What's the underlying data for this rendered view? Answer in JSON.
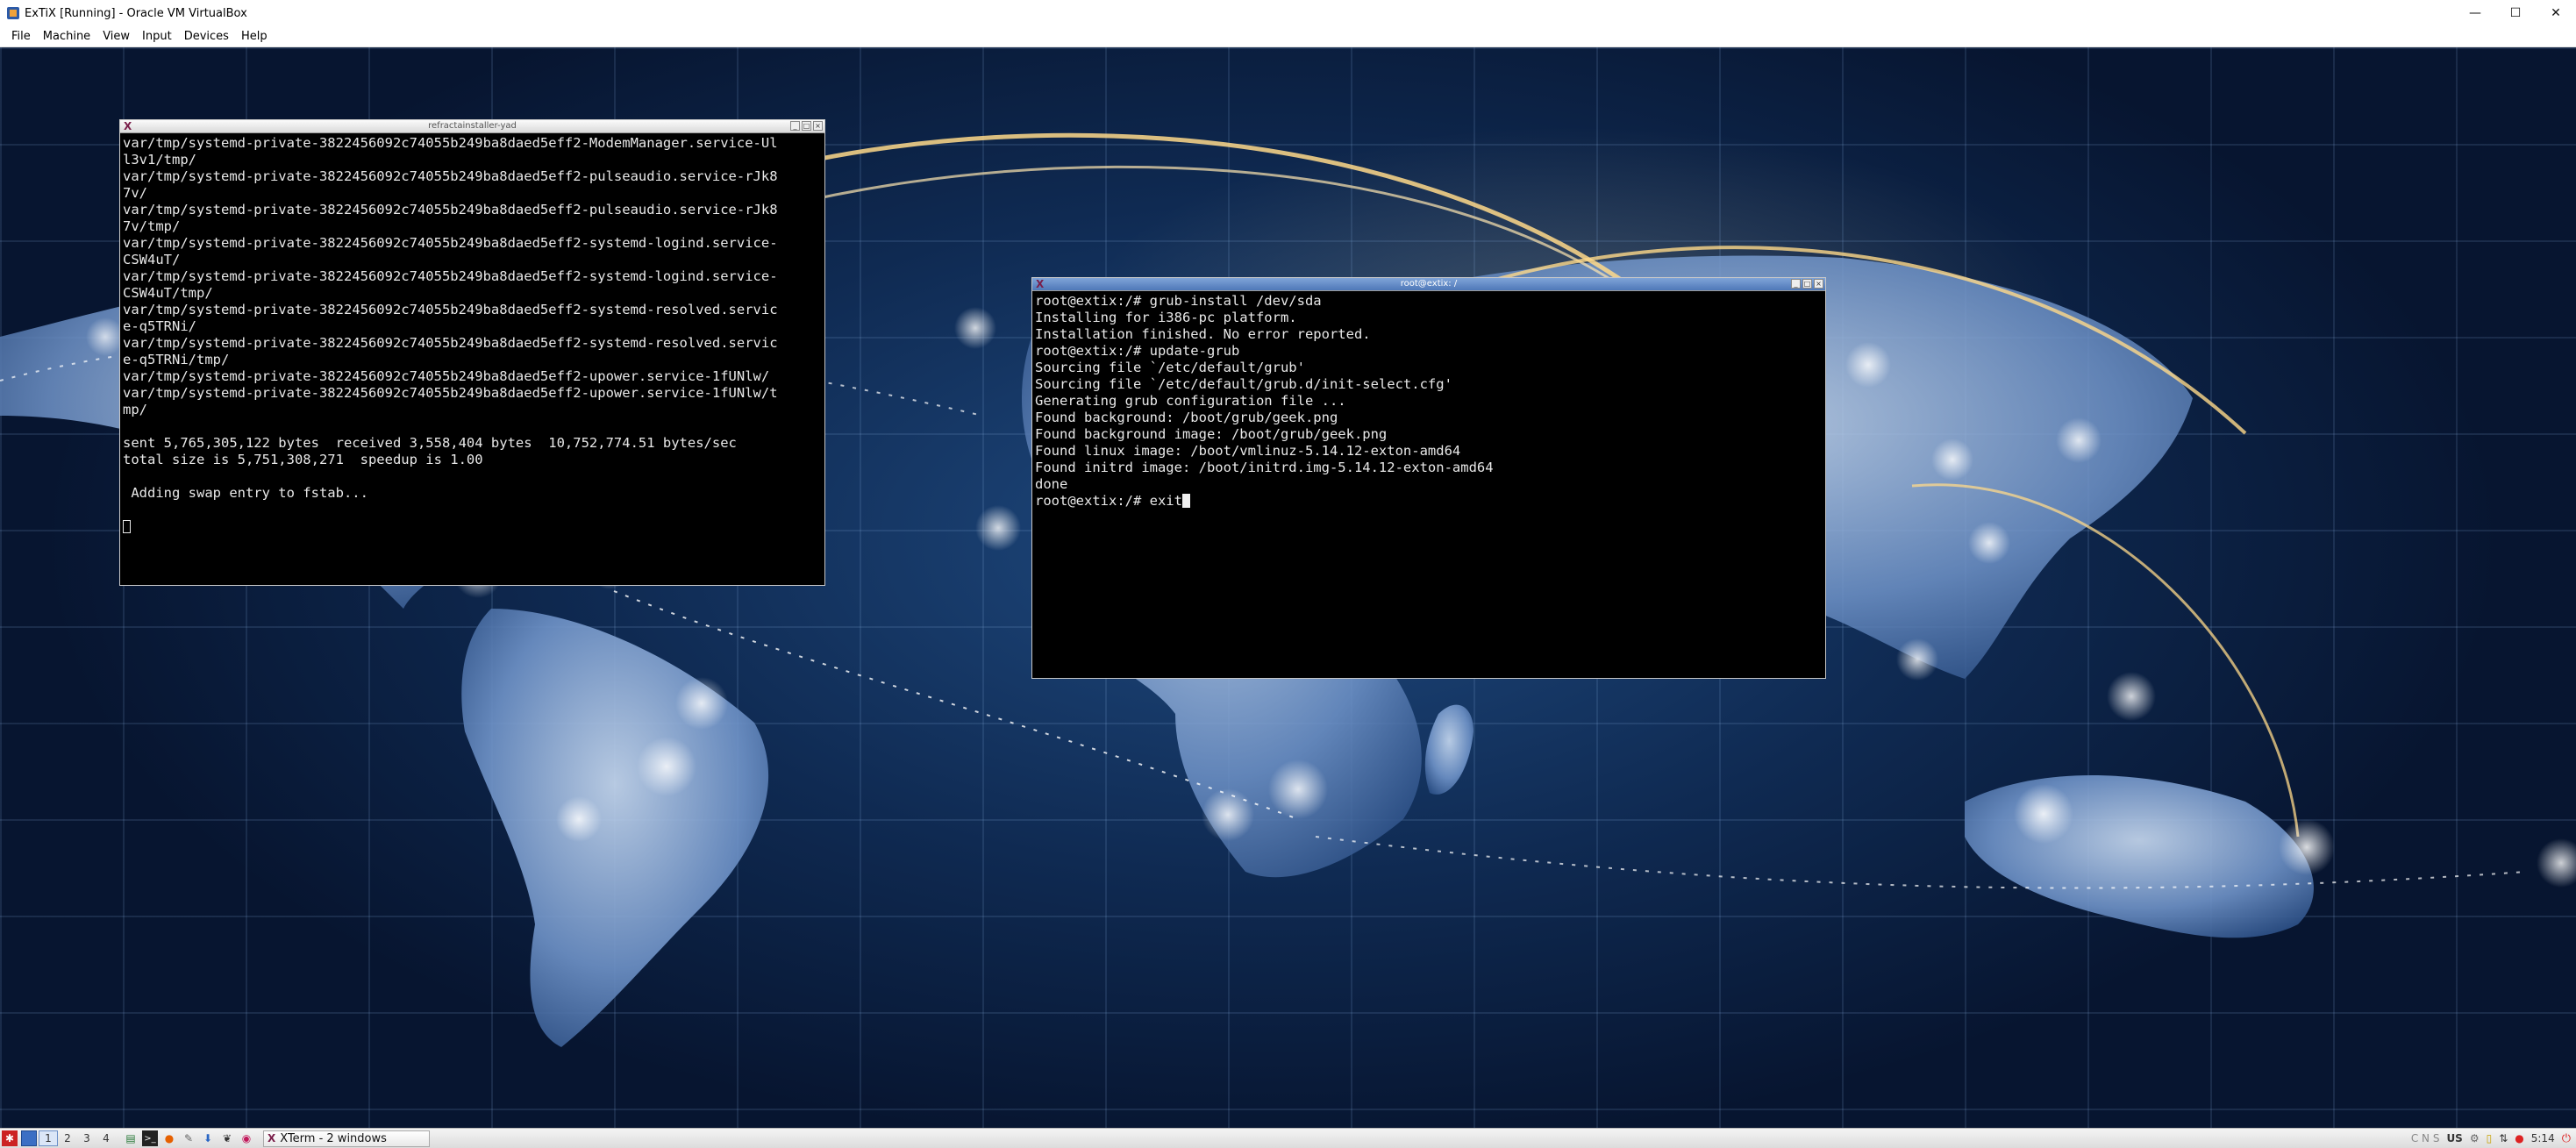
{
  "host": {
    "title": "ExTiX [Running] - Oracle VM VirtualBox",
    "controls": {
      "minimize": "—",
      "maximize": "☐",
      "close": "✕"
    },
    "menu": [
      "File",
      "Machine",
      "View",
      "Input",
      "Devices",
      "Help"
    ]
  },
  "xterm_left": {
    "title": "refractainstaller-yad",
    "lines": [
      "var/tmp/systemd-private-3822456092c74055b249ba8daed5eff2-ModemManager.service-Ul",
      "l3v1/tmp/",
      "var/tmp/systemd-private-3822456092c74055b249ba8daed5eff2-pulseaudio.service-rJk8",
      "7v/",
      "var/tmp/systemd-private-3822456092c74055b249ba8daed5eff2-pulseaudio.service-rJk8",
      "7v/tmp/",
      "var/tmp/systemd-private-3822456092c74055b249ba8daed5eff2-systemd-logind.service-",
      "CSW4uT/",
      "var/tmp/systemd-private-3822456092c74055b249ba8daed5eff2-systemd-logind.service-",
      "CSW4uT/tmp/",
      "var/tmp/systemd-private-3822456092c74055b249ba8daed5eff2-systemd-resolved.servic",
      "e-q5TRNi/",
      "var/tmp/systemd-private-3822456092c74055b249ba8daed5eff2-systemd-resolved.servic",
      "e-q5TRNi/tmp/",
      "var/tmp/systemd-private-3822456092c74055b249ba8daed5eff2-upower.service-1fUNlw/",
      "var/tmp/systemd-private-3822456092c74055b249ba8daed5eff2-upower.service-1fUNlw/t",
      "mp/",
      "",
      "sent 5,765,305,122 bytes  received 3,558,404 bytes  10,752,774.51 bytes/sec",
      "total size is 5,751,308,271  speedup is 1.00",
      "",
      " Adding swap entry to fstab...",
      ""
    ]
  },
  "xterm_right": {
    "title": "root@extix: /",
    "lines": [
      "root@extix:/# grub-install /dev/sda",
      "Installing for i386-pc platform.",
      "Installation finished. No error reported.",
      "root@extix:/# update-grub",
      "Sourcing file `/etc/default/grub'",
      "Sourcing file `/etc/default/grub.d/init-select.cfg'",
      "Generating grub configuration file ...",
      "Found background: /boot/grub/geek.png",
      "Found background image: /boot/grub/geek.png",
      "Found linux image: /boot/vmlinuz-5.14.12-exton-amd64",
      "Found initrd image: /boot/initrd.img-5.14.12-exton-amd64",
      "done"
    ],
    "prompt": "root@extix:/# exit"
  },
  "taskbar": {
    "workspaces": [
      "1",
      "2",
      "3",
      "4"
    ],
    "task_label": "XTerm - 2 windows",
    "tray_indicators": "C N S",
    "keyboard_layout": "US",
    "clock": "5:14"
  }
}
